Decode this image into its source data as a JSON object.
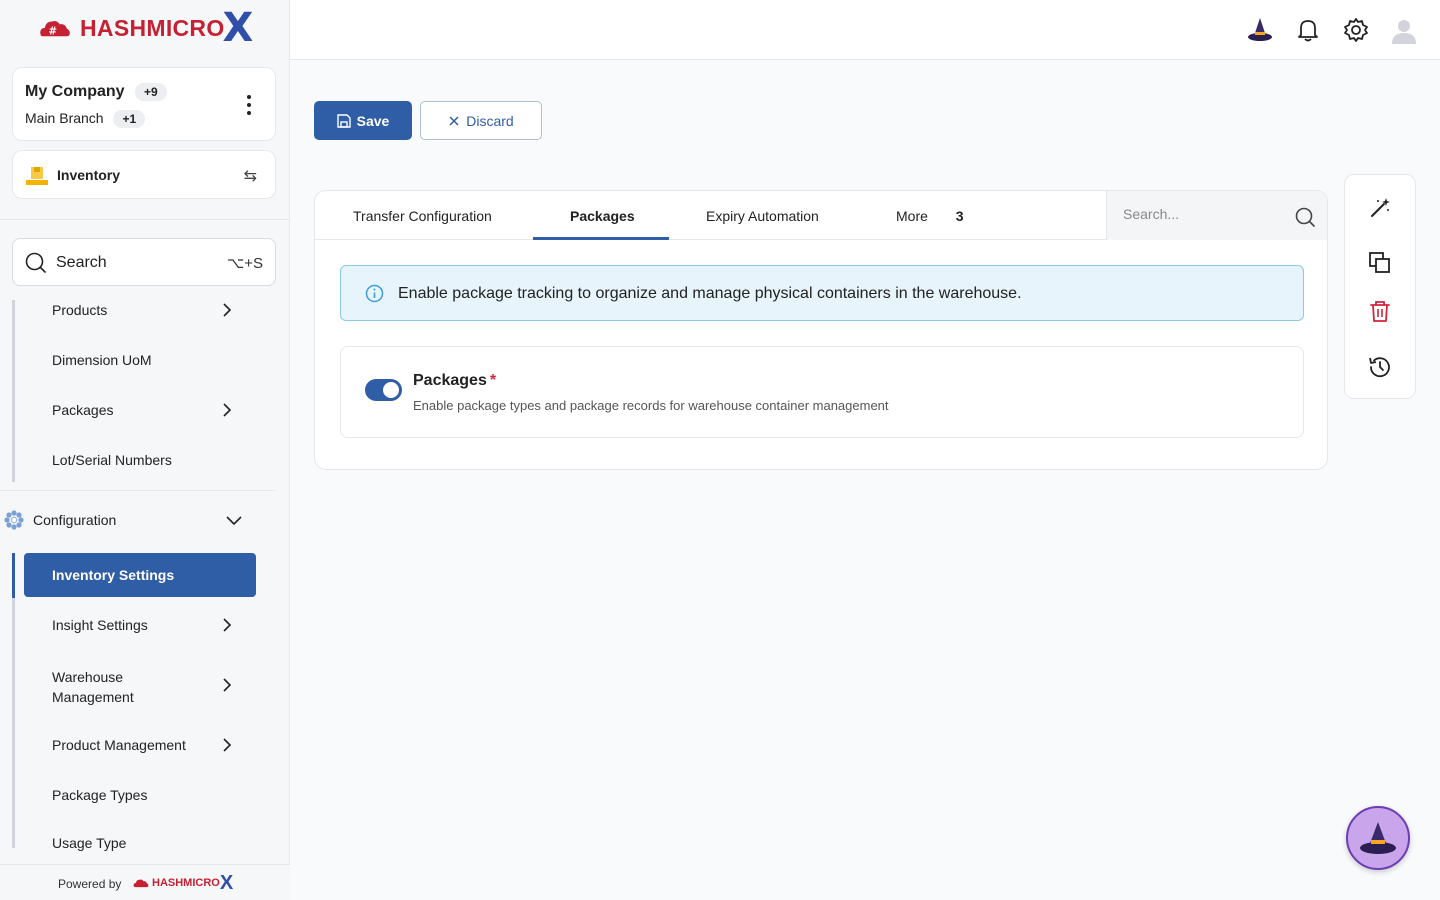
{
  "brand": {
    "name_bold": "HASHMICRO",
    "name_x": "X"
  },
  "company": {
    "name": "My Company",
    "company_badge": "+9",
    "branch": "Main Branch",
    "branch_badge": "+1"
  },
  "module": {
    "label": "Inventory"
  },
  "sidebar_search": {
    "label": "Search",
    "shortcut": "⌥+S"
  },
  "nav": {
    "products": "Products",
    "dimension_uom": "Dimension UoM",
    "packages": "Packages",
    "lot_serial": "Lot/Serial Numbers",
    "configuration": "Configuration",
    "inventory_settings": "Inventory Settings",
    "insight_settings": "Insight Settings",
    "warehouse_management_1": "Warehouse",
    "warehouse_management_2": "Management",
    "product_management": "Product Management",
    "package_types": "Package Types",
    "usage_type": "Usage Type"
  },
  "footer": {
    "powered_by": "Powered by",
    "brand": "HASHMICRO"
  },
  "toolbar": {
    "save_label": "Save",
    "discard_label": "Discard"
  },
  "tabs": {
    "transfer": "Transfer Configuration",
    "packages": "Packages",
    "expiry": "Expiry Automation",
    "more": "More",
    "more_count": "3",
    "search_placeholder": "Search..."
  },
  "banner": {
    "text": "Enable package tracking to organize and manage physical containers in the warehouse."
  },
  "setting": {
    "title": "Packages",
    "required_mark": "*",
    "description": "Enable package types and package records for warehouse container management",
    "enabled": true
  },
  "colors": {
    "primary": "#2f5da6",
    "brand_red": "#c62132",
    "brand_blue": "#2f4fa8",
    "info_bg": "#e7f4fb",
    "danger": "#d3263a"
  },
  "icons": {
    "top": [
      "wizard-hat-icon",
      "bell-icon",
      "gear-icon",
      "user-avatar-icon"
    ],
    "actions": [
      "magic-wand-icon",
      "duplicate-icon",
      "trash-icon",
      "history-icon"
    ]
  }
}
